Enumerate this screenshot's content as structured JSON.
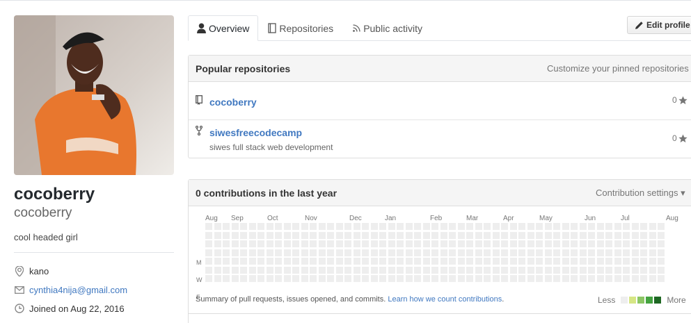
{
  "profile": {
    "fullname": "cocoberry",
    "username": "cocoberry",
    "bio": "cool headed girl",
    "location": "kano",
    "email": "cynthia4nija@gmail.com",
    "joined": "Joined on Aug 22, 2016"
  },
  "tabs": [
    {
      "label": "Overview",
      "icon": "person-icon",
      "active": true
    },
    {
      "label": "Repositories",
      "icon": "book-icon"
    },
    {
      "label": "Public activity",
      "icon": "rss-icon"
    }
  ],
  "edit_profile_label": "Edit profile",
  "popular": {
    "title": "Popular repositories",
    "customize_label": "Customize your pinned repositories",
    "repos": [
      {
        "name": "cocoberry",
        "description": "",
        "stars": "0",
        "icon": "repo-icon"
      },
      {
        "name": "siwesfreecodecamp",
        "description": "siwes full stack web development",
        "stars": "0",
        "icon": "repo-forked-icon"
      }
    ]
  },
  "contributions": {
    "title": "0 contributions in the last year",
    "settings_label": "Contribution settings ▾",
    "months": [
      "Aug",
      "Sep",
      "Oct",
      "Nov",
      "Dec",
      "Jan",
      "Feb",
      "Mar",
      "Apr",
      "May",
      "Jun",
      "Jul",
      "Aug"
    ],
    "days": [
      "M",
      "W",
      "F"
    ],
    "summary_text": "Summary of pull requests, issues opened, and commits.",
    "summary_link": "Learn how we count contributions",
    "summary_end": ".",
    "legend_less": "Less",
    "legend_more": "More",
    "legend_colors": [
      "#eeeeee",
      "#d6e685",
      "#8cc665",
      "#44a340",
      "#1e6823"
    ]
  }
}
